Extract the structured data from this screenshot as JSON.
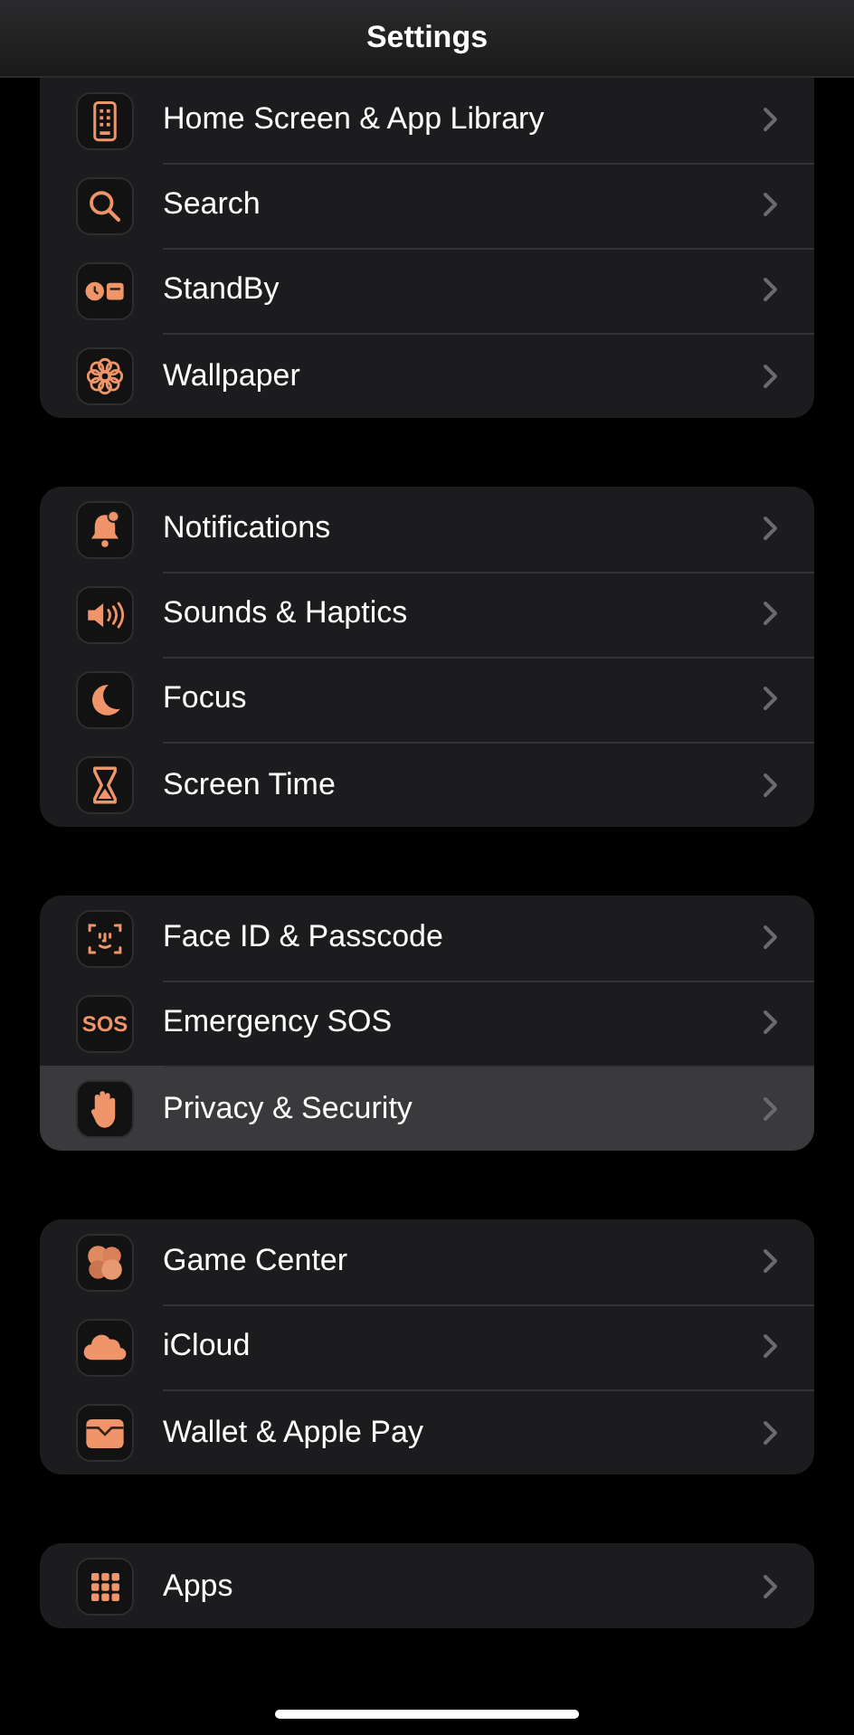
{
  "navigation_bar": {
    "title": "Settings"
  },
  "groups": [
    {
      "rows": [
        {
          "label": "Home Screen & App Library",
          "selected": false
        },
        {
          "label": "Search",
          "selected": false
        },
        {
          "label": "StandBy",
          "selected": false
        },
        {
          "label": "Wallpaper",
          "selected": false
        }
      ]
    },
    {
      "rows": [
        {
          "label": "Notifications",
          "selected": false
        },
        {
          "label": "Sounds & Haptics",
          "selected": false
        },
        {
          "label": "Focus",
          "selected": false
        },
        {
          "label": "Screen Time",
          "selected": false
        }
      ]
    },
    {
      "rows": [
        {
          "label": "Face ID & Passcode",
          "selected": false
        },
        {
          "label": "Emergency SOS",
          "selected": false,
          "icon_text": "SOS"
        },
        {
          "label": "Privacy & Security",
          "selected": true
        }
      ]
    },
    {
      "rows": [
        {
          "label": "Game Center",
          "selected": false
        },
        {
          "label": "iCloud",
          "selected": false
        },
        {
          "label": "Wallet & Apple Pay",
          "selected": false
        }
      ]
    },
    {
      "rows": [
        {
          "label": "Apps",
          "selected": false
        }
      ]
    }
  ]
}
